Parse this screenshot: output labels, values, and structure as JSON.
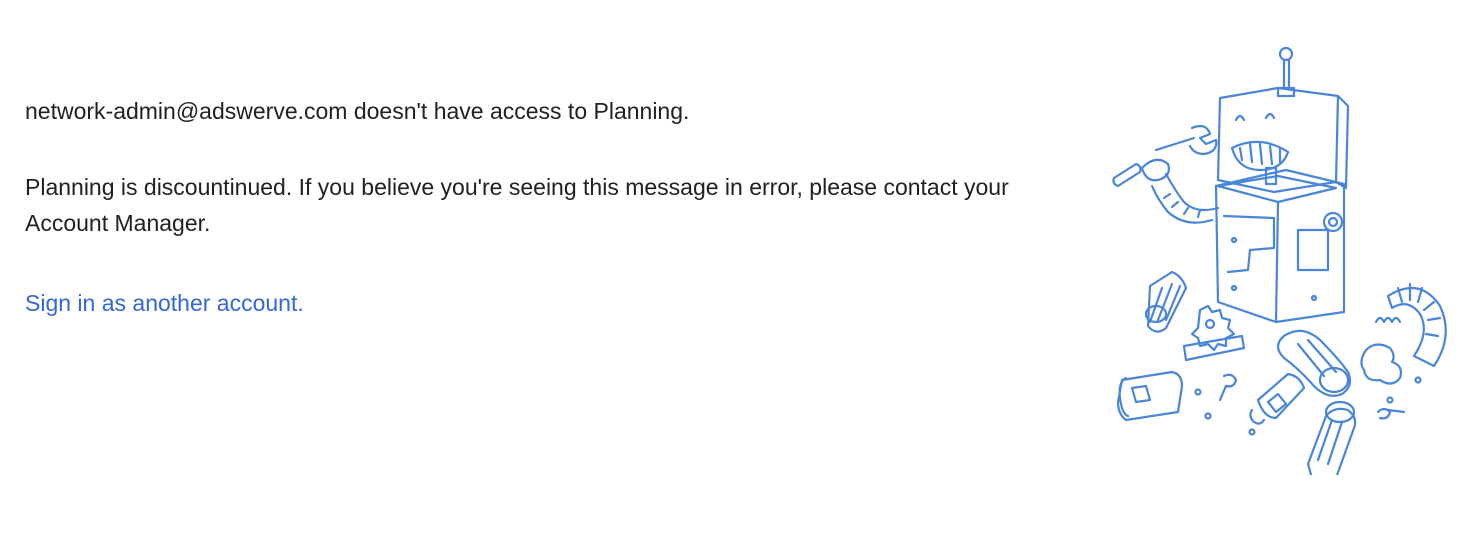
{
  "error": {
    "access_message": "network-admin@adswerve.com doesn't have access to Planning.",
    "discontinued_message": "Planning is discountinued. If you believe you're seeing this message in error, please contact your Account Manager.",
    "signin_link": "Sign in as another account."
  },
  "illustration": {
    "icon": "broken-robot-illustration",
    "color": "#4a86d8"
  },
  "colors": {
    "text": "#202124",
    "link": "#3367d6",
    "background": "#ffffff"
  }
}
